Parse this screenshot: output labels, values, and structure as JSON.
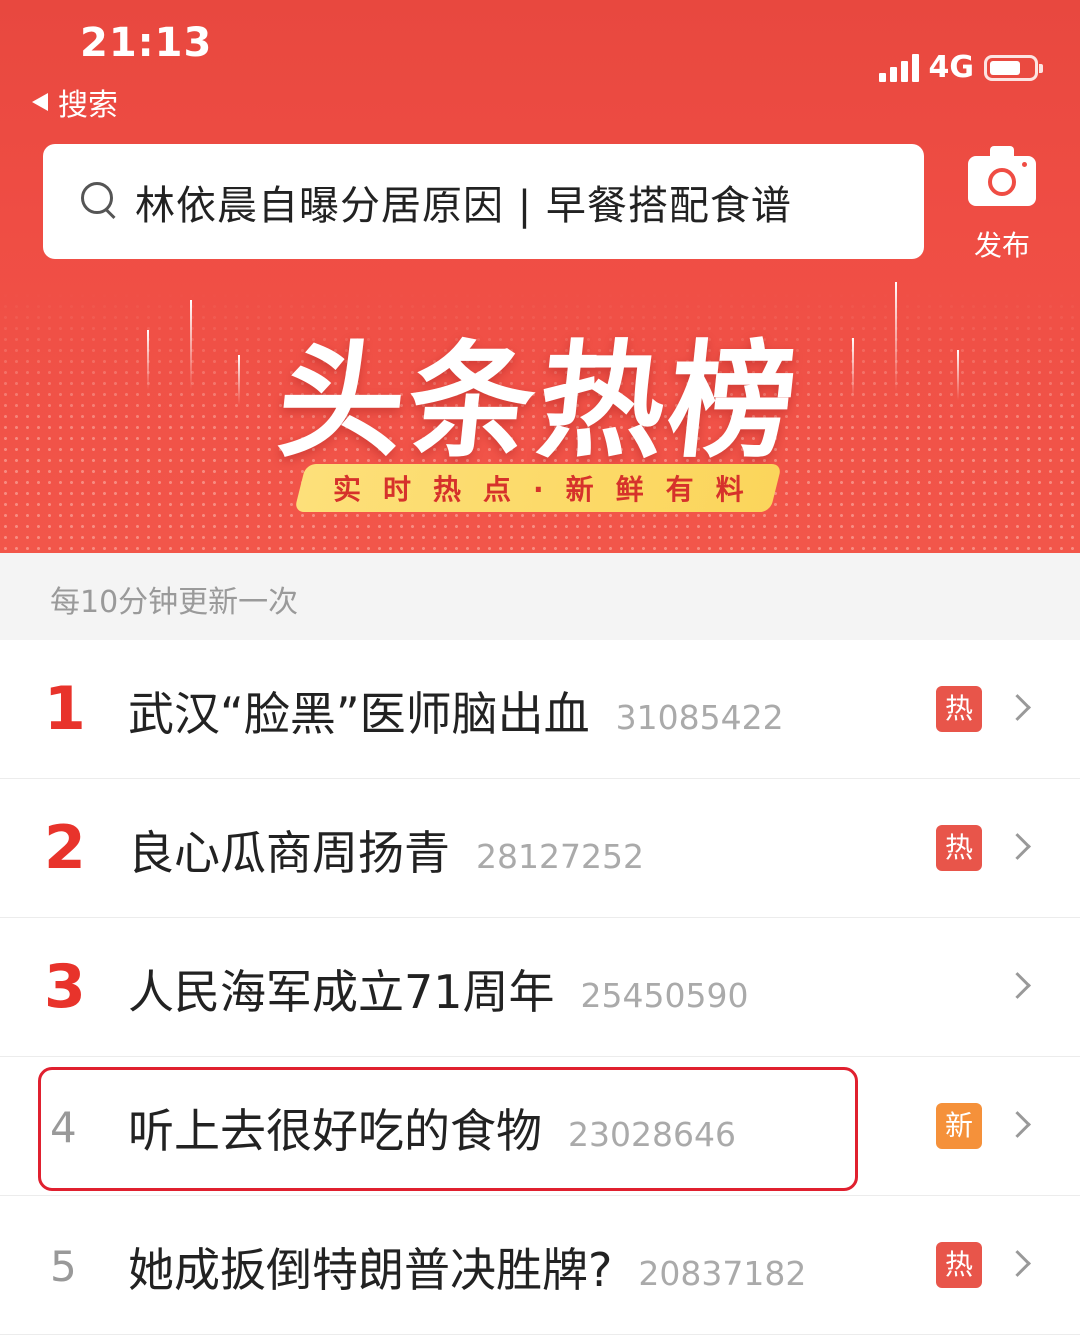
{
  "status_bar": {
    "time": "21:13",
    "back_label": "搜索",
    "network": "4G"
  },
  "search": {
    "placeholder": "林依晨自曝分居原因 | 早餐搭配食谱"
  },
  "publish": {
    "label": "发布",
    "icon": "camera-icon"
  },
  "banner": {
    "title": "头条热榜",
    "tagline": "实时热点·新鲜有料"
  },
  "notice": "每10分钟更新一次",
  "hot_list": [
    {
      "rank": "1",
      "title": "武汉“脸黑”医师脑出血",
      "count": "31085422",
      "badge": "热"
    },
    {
      "rank": "2",
      "title": "良心瓜商周扬青",
      "count": "28127252",
      "badge": "热"
    },
    {
      "rank": "3",
      "title": "人民海军成立71周年",
      "count": "25450590",
      "badge": ""
    },
    {
      "rank": "4",
      "title": "听上去很好吃的食物",
      "count": "23028646",
      "badge": "新"
    },
    {
      "rank": "5",
      "title": "她成扳倒特朗普决胜牌?",
      "count": "20837182",
      "badge": "热"
    }
  ],
  "colors": {
    "header_red": "#ef4d44",
    "rank_red": "#e8332b",
    "hot_badge": "#e8554a",
    "new_badge": "#f5913a",
    "highlight_border": "#e0202f"
  }
}
